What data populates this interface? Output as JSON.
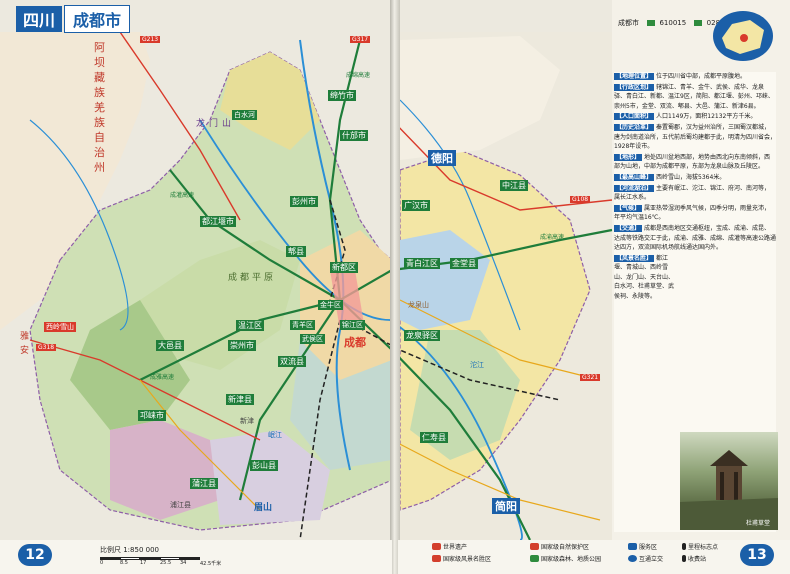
{
  "header": {
    "province": "四川",
    "city": "成都市"
  },
  "header_right": {
    "name": "成都市",
    "code": "610015",
    "area_code": "028"
  },
  "page_numbers": {
    "left": "12",
    "right": "13"
  },
  "scale": {
    "text": "比例尺 1:850 000",
    "ticks": [
      "0",
      "8.5",
      "17",
      "25.5",
      "34",
      "42.5千米"
    ]
  },
  "legend": [
    {
      "text": "世界遗产",
      "color": "#d33f2d"
    },
    {
      "text": "国家级自然保护区",
      "color": "#d33f2d"
    },
    {
      "text": "服务区",
      "color": "#1b5fa8"
    },
    {
      "text": "里程标志点",
      "color": "#222222"
    },
    {
      "text": "国家级风景名胜区",
      "color": "#d33f2d"
    },
    {
      "text": "国家级森林、地质公园",
      "color": "#2e8b3d"
    },
    {
      "text": "互通立交",
      "color": "#1b5fa8"
    },
    {
      "text": "收费站",
      "color": "#222222"
    }
  ],
  "map_labels": {
    "districts": [
      "都江堰市",
      "彭州市",
      "什邡市",
      "德阳",
      "绵竹市",
      "广汉市",
      "新都区",
      "青白江区",
      "金堂县",
      "成都",
      "金牛区",
      "锦江区",
      "武侯区",
      "青羊区",
      "龙泉驿区",
      "双流县",
      "温江区",
      "郫县",
      "崇州市",
      "新津县",
      "大邑县",
      "邛崃市",
      "蒲江县",
      "龙泉山",
      "简阳",
      "中江县",
      "仁寿县",
      "彭山县",
      "眉山",
      "浦江县",
      "新津"
    ],
    "features": [
      "阿坝藏族羌族自治州",
      "龙门山",
      "白水河",
      "西岭雪山",
      "成都平原",
      "岷江",
      "沱江",
      "雅安"
    ],
    "roads": [
      "G213",
      "G317",
      "G318",
      "G108",
      "G321",
      "成渝高速",
      "成雅高速",
      "成绵高速",
      "成灌高速"
    ]
  },
  "intro": [
    {
      "label": "【地理位置】",
      "text": "位于四川省中部，成都平原腹地。"
    },
    {
      "label": "【行政区划】",
      "text": "辖锦江、青羊、金牛、武侯、成华、龙泉驿、青白江、新都、温江9区，简阳、都江堰、彭州、邛崃、崇州5市，金堂、双流、郫县、大邑、蒲江、新津6县。"
    },
    {
      "label": "【人口面积】",
      "text": "人口1149万，面积12132平方千米。"
    },
    {
      "label": "【历史沿革】",
      "text": "秦置蜀郡，汉为益州治所，三国蜀汉都城，唐为剑南道治所，五代前后蜀均建都于此，明清为四川省会，1928年设市。"
    },
    {
      "label": "【地形】",
      "text": "地处四川盆地西部，地势由西北向东南倾斜，西部为山地，中部为成都平原，东部为龙泉山脉及丘陵区。"
    },
    {
      "label": "【最高山峰】",
      "text": "西岭雪山，海拔5364米。"
    },
    {
      "label": "【河流湖泊】",
      "text": "主要有岷江、沱江、锦江、府河、南河等，属长江水系。"
    },
    {
      "label": "【气候】",
      "text": "属亚热带湿润季风气候，四季分明，雨量充沛，年平均气温16℃。"
    },
    {
      "label": "【交通】",
      "text": "成都是西南地区交通枢纽，宝成、成渝、成昆、达成等铁路交汇于此，成渝、成雅、成绵、成灌等高速公路通达四方，双流国际机场航线通达国内外。"
    },
    {
      "label": "【风景名胜】",
      "text": "都江堰、青城山、西岭雪山、龙门山、天台山、白水河、杜甫草堂、武侯祠、永陵等。"
    }
  ],
  "photo_caption": "杜甫草堂"
}
